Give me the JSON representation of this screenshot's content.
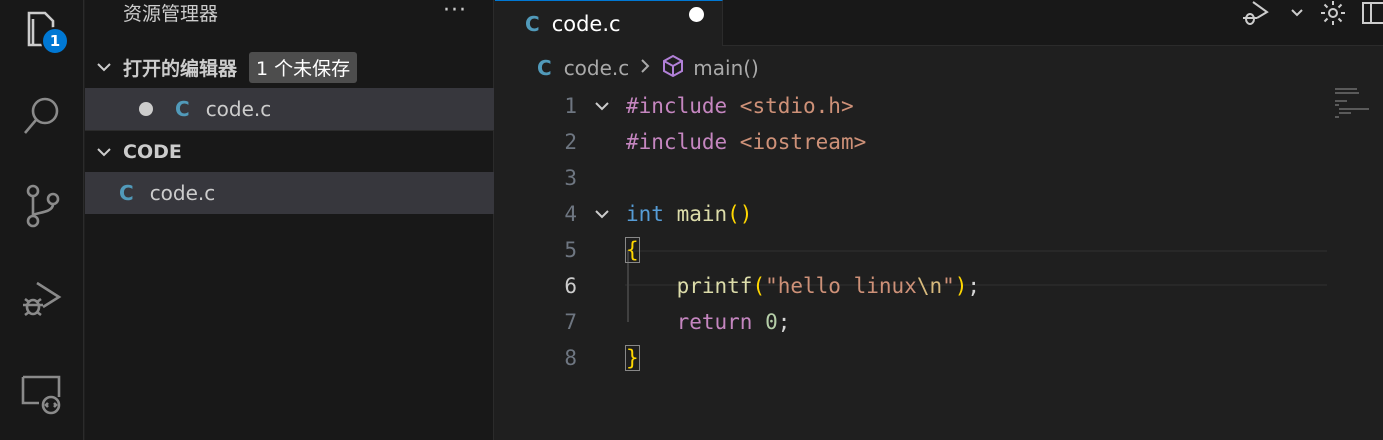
{
  "activity": {
    "items": [
      {
        "name": "explorer-icon"
      },
      {
        "name": "search-icon"
      },
      {
        "name": "source-control-icon"
      },
      {
        "name": "run-debug-icon"
      },
      {
        "name": "remote-explorer-icon"
      }
    ],
    "explorer_badge": "1"
  },
  "sidebar": {
    "title": "资源管理器",
    "more": "···",
    "open_editors": {
      "label": "打开的编辑器",
      "unsaved": "1 个未保存",
      "files": [
        {
          "icon": "C",
          "name": "code.c"
        }
      ]
    },
    "folder": {
      "label": "CODE",
      "files": [
        {
          "icon": "C",
          "name": "code.c"
        }
      ]
    }
  },
  "editor": {
    "tab": {
      "icon": "C",
      "label": "code.c"
    },
    "breadcrumb": {
      "file_icon": "C",
      "file": "code.c",
      "symbol": "main()"
    },
    "lines": [
      {
        "n": "1",
        "fold": true
      },
      {
        "n": "2"
      },
      {
        "n": "3"
      },
      {
        "n": "4",
        "fold": true
      },
      {
        "n": "5"
      },
      {
        "n": "6",
        "current": true
      },
      {
        "n": "7"
      },
      {
        "n": "8"
      }
    ],
    "code": {
      "l1_a": "#include",
      "l1_b": " <stdio.h>",
      "l2_a": "#include",
      "l2_b": " <iostream>",
      "l4_a": "int",
      "l4_b": " main",
      "l4_c": "()",
      "l5_a": "{",
      "l6_indent": "    ",
      "l6_a": "printf",
      "l6_b": "(",
      "l6_c": "\"hello linux",
      "l6_d": "\\n",
      "l6_e": "\"",
      "l6_f": ")",
      "l6_g": ";",
      "l7_indent": "    ",
      "l7_a": "return",
      "l7_b": " ",
      "l7_c": "0",
      "l7_d": ";",
      "l8_a": "}"
    }
  },
  "colors": {
    "accent": "#0078d4",
    "c_icon": "#519aba"
  }
}
